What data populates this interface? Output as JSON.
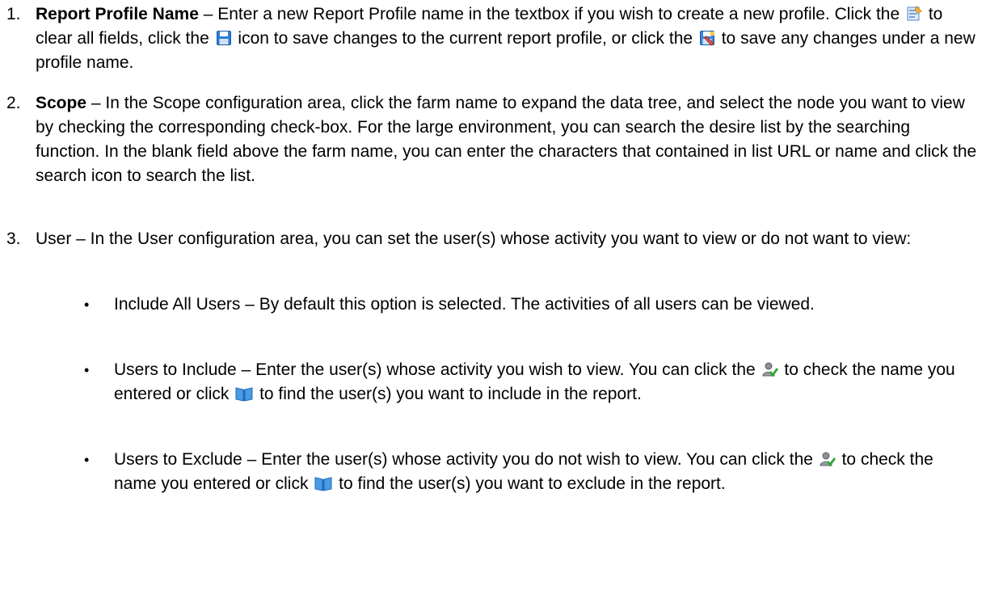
{
  "items": [
    {
      "number": "1.",
      "title": "Report Profile Name",
      "dash": " – ",
      "text_a": "Enter a new Report Profile name in the textbox if you wish to create a new profile. Click the ",
      "text_b": " to clear all fields, click the ",
      "text_c": " icon to save changes to the current report profile, or click the ",
      "text_d": " to save any changes under a new profile name."
    },
    {
      "number": "2.",
      "title": "Scope",
      "dash": " – ",
      "text": "In the Scope configuration area, click the farm name to expand the data tree, and select the node you want to view by checking the corresponding check-box. For the large environment, you can search the desire list by the searching function. In the blank field above the farm name, you can enter the characters that contained in list URL or name and click the search icon to search the list."
    },
    {
      "number": "3.",
      "text": "User – In the User configuration area, you can set the user(s) whose activity you want to view or do not want to view:"
    }
  ],
  "bullets": [
    {
      "symbol": "•",
      "text": "Include All Users – By default this option is selected. The activities of all users can be viewed."
    },
    {
      "symbol": "•",
      "text_a": "Users to Include – Enter the user(s) whose activity you wish to view. You can click the ",
      "text_b": " to check the name you entered or click ",
      "text_c": " to find the user(s) you want to include in the report."
    },
    {
      "symbol": "•",
      "text_a": "Users to Exclude – Enter the user(s) whose activity you do not wish to view. You can click the ",
      "text_b": " to check the name you entered or click ",
      "text_c": " to find the user(s) you want to exclude in the report."
    }
  ],
  "icons": {
    "clear": "clear-fields-icon",
    "save": "save-icon",
    "save_as": "save-as-icon",
    "check_names": "check-names-icon",
    "address_book": "address-book-icon"
  }
}
